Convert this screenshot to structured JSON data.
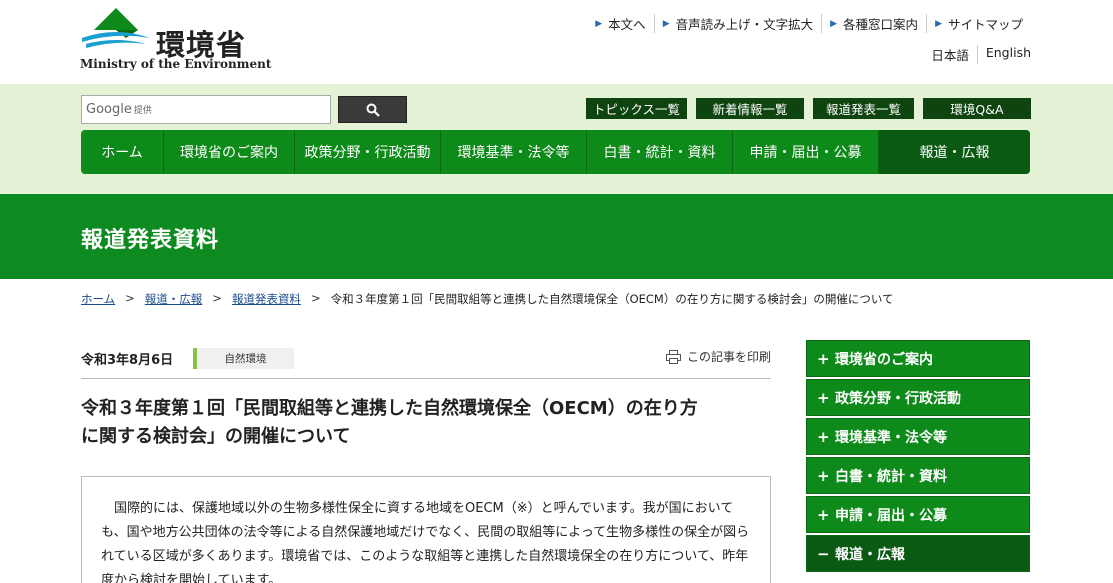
{
  "header": {
    "logo_text": "環境省",
    "logo_sub": "Ministry of the Environment",
    "util_links": [
      "本文へ",
      "音声読み上げ・文字拡大",
      "各種窓口案内",
      "サイトマップ"
    ],
    "lang_links": [
      "日本語",
      "English"
    ]
  },
  "search": {
    "provider": "Google",
    "provider_suffix": "提供",
    "placeholder": ""
  },
  "quick_links": [
    "トピックス一覧",
    "新着情報一覧",
    "報道発表一覧",
    "環境Q&A"
  ],
  "global_nav": [
    "ホーム",
    "環境省のご案内",
    "政策分野・行政活動",
    "環境基準・法令等",
    "白書・統計・資料",
    "申請・届出・公募",
    "報道・広報"
  ],
  "banner": {
    "title": "報道発表資料"
  },
  "breadcrumb": {
    "items": [
      "ホーム",
      "報道・広報",
      "報道発表資料"
    ],
    "separator": ">",
    "current": "令和３年度第１回「民間取組等と連携した自然環境保全（OECM）の在り方に関する検討会」の開催について"
  },
  "article": {
    "date": "令和3年8月6日",
    "category": "自然環境",
    "print_label": "この記事を印刷",
    "title_line1": "令和３年度第１回「民間取組等と連携した自然環境保全（OECM）の在り方",
    "title_line2": "に関する検討会」の開催について",
    "body": "国際的には、保護地域以外の生物多様性保全に資する地域をOECM（※）と呼んでいます。我が国においても、国や地方公共団体の法令等による自然保護地域だけでなく、民間の取組等によって生物多様性の保全が図られている区域が多くあります。環境省では、このような取組等と連携した自然環境保全の在り方について、昨年度から検討を開始しています。"
  },
  "side_nav": [
    {
      "sign": "+",
      "label": "環境省のご案内"
    },
    {
      "sign": "+",
      "label": "政策分野・行政活動"
    },
    {
      "sign": "+",
      "label": "環境基準・法令等"
    },
    {
      "sign": "+",
      "label": "白書・統計・資料"
    },
    {
      "sign": "+",
      "label": "申請・届出・公募"
    },
    {
      "sign": "−",
      "label": "報道・広報"
    }
  ],
  "colors": {
    "primary_green": "#0e8a1a",
    "dark_green": "#0b5a14",
    "light_band": "#e4f2d5"
  },
  "icons": {
    "search": "search-icon",
    "print": "printer-icon"
  }
}
